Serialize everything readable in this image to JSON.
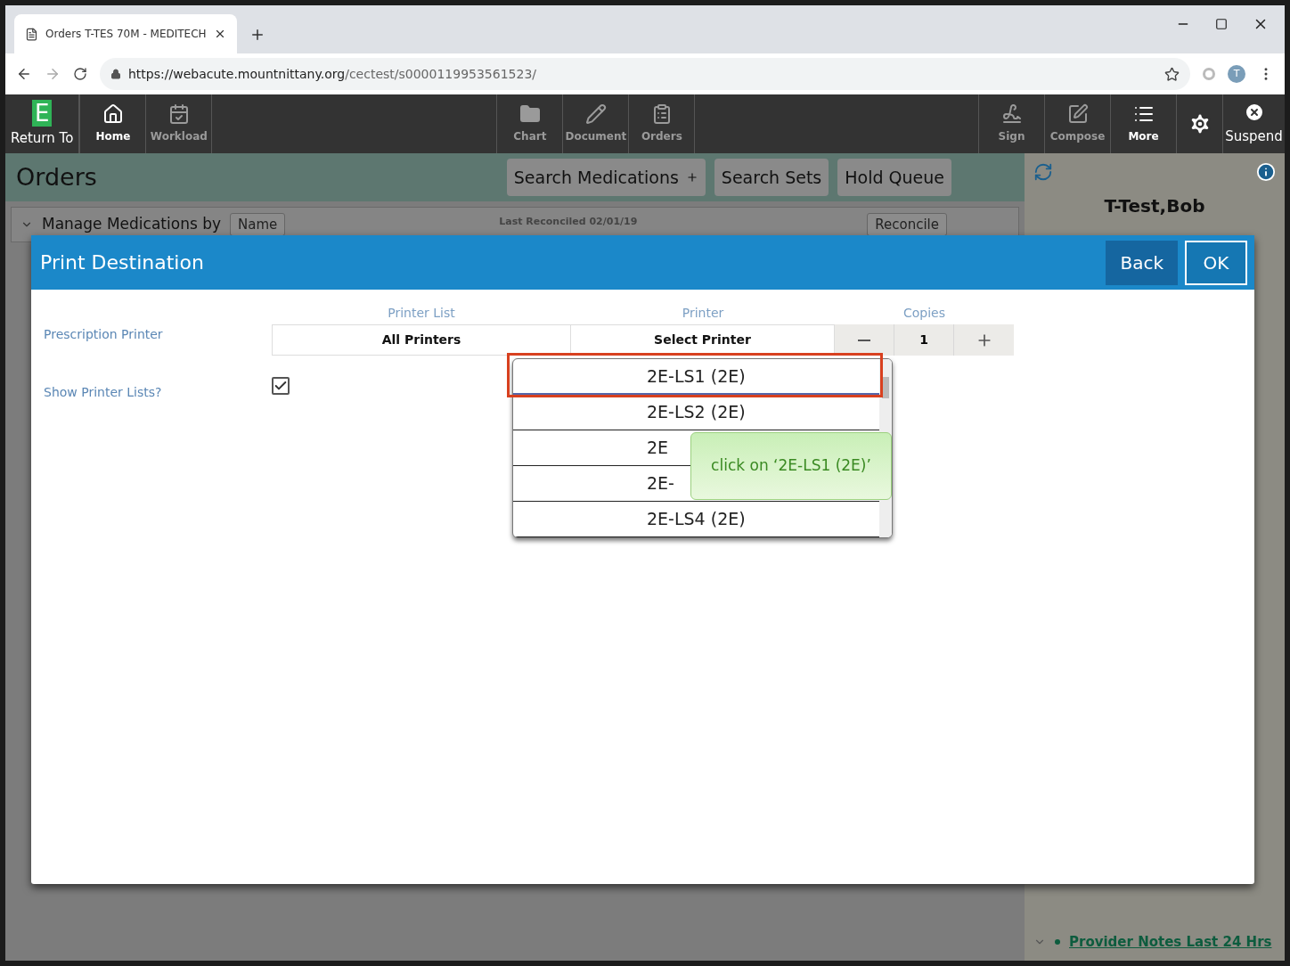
{
  "browser": {
    "tab_title": "Orders T-TES 70M - MEDITECH",
    "url_host": "https://webacute.mountnittany.org",
    "url_path": "/cectest/s0000119953561523/",
    "profile_initial": "T"
  },
  "toolbar": {
    "left": [
      {
        "label": "Return To",
        "kind": "logo",
        "logo_letter": "E",
        "disabled": false
      },
      {
        "label": "Home",
        "kind": "home",
        "disabled": false
      },
      {
        "label": "Workload",
        "kind": "workload",
        "disabled": true
      }
    ],
    "center": [
      {
        "label": "Chart",
        "kind": "chart",
        "disabled": true
      },
      {
        "label": "Document",
        "kind": "document",
        "disabled": true
      },
      {
        "label": "Orders",
        "kind": "orders",
        "disabled": true
      }
    ],
    "right": [
      {
        "label": "Sign",
        "kind": "sign",
        "disabled": true
      },
      {
        "label": "Compose",
        "kind": "compose",
        "disabled": true
      },
      {
        "label": "More",
        "kind": "more",
        "disabled": false
      },
      {
        "kind": "settings",
        "disabled": false
      },
      {
        "label": "Suspend",
        "kind": "suspend",
        "disabled": false
      }
    ]
  },
  "page": {
    "title": "Orders",
    "buttons": [
      "Search Medications",
      "Search Sets",
      "Hold Queue"
    ]
  },
  "background_panel": {
    "section_title": "Manage Medications by",
    "sort_button": "Name",
    "last_reconciled": "Last Reconciled 02/01/19",
    "reconcile_button": "Reconcile"
  },
  "patient_panel": {
    "name": "T-Test,Bob",
    "link": "Provider Notes Last 24 Hrs"
  },
  "dialog": {
    "title": "Print Destination",
    "buttons": [
      {
        "label": "Back",
        "kind": "secondary"
      },
      {
        "label": "OK",
        "kind": "primary"
      }
    ],
    "row_label": "Prescription Printer",
    "columns": [
      "Printer List",
      "Printer",
      "Copies"
    ],
    "printer_list": "All Printers",
    "printer": "Select Printer",
    "copies": "1",
    "show_lists": {
      "label": "Show Printer Lists?",
      "checked": true
    },
    "dropdown": [
      {
        "label": "2E-LS1 (2E)",
        "selected": true,
        "highlighted": true
      },
      {
        "label": "2E-LS2 (2E)",
        "selected": false,
        "highlighted": false
      },
      {
        "label": "2E",
        "selected": false,
        "highlighted": false
      },
      {
        "label": "2E-",
        "selected": false,
        "highlighted": false
      },
      {
        "label": "2E-LS4 (2E)",
        "selected": false,
        "highlighted": false
      }
    ],
    "hint": "click on ‘2E-LS1 (2E)’"
  }
}
